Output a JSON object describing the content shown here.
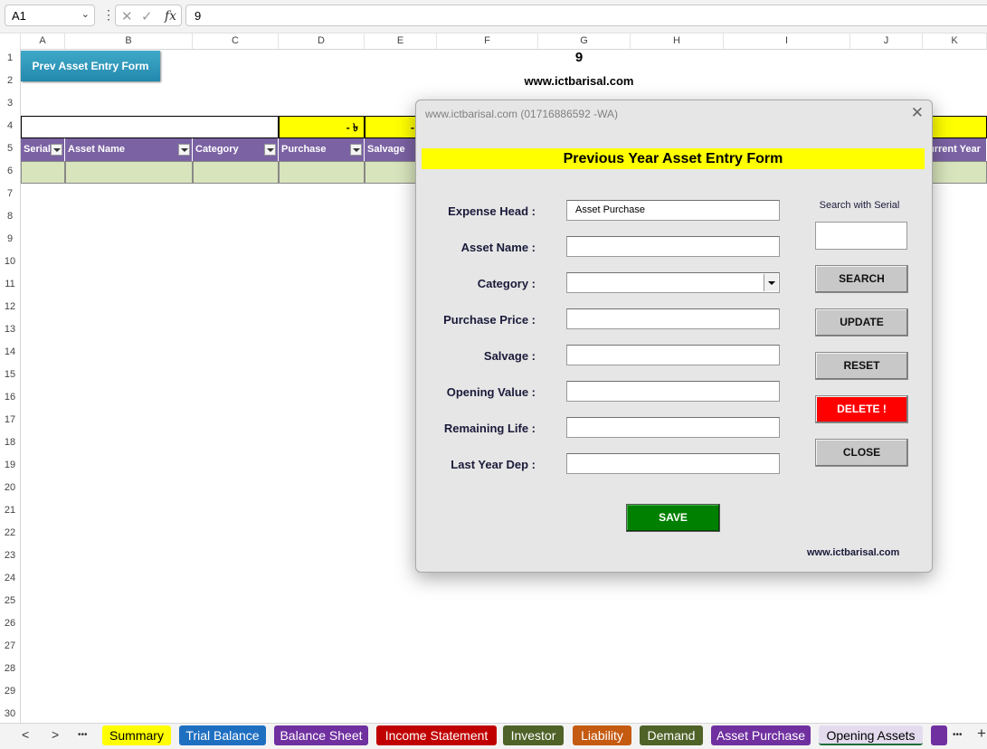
{
  "formula_bar": {
    "name_box": "A1",
    "fx": "fx",
    "value": "9"
  },
  "columns": [
    "A",
    "B",
    "C",
    "D",
    "E",
    "F",
    "G",
    "H",
    "I",
    "J",
    "K"
  ],
  "rows": [
    "1",
    "2",
    "3",
    "4",
    "5",
    "6",
    "7",
    "8",
    "9",
    "10",
    "11",
    "12",
    "13",
    "14",
    "15",
    "16",
    "17",
    "18",
    "19",
    "20",
    "21",
    "22",
    "23",
    "24",
    "25",
    "26",
    "27",
    "28",
    "29",
    "30"
  ],
  "sheet": {
    "prev_button": "Prev Asset Entry Form",
    "title_number": "9",
    "website": "www.ictbarisal.com",
    "row4": {
      "d_value": "-  ৳",
      "e_value": "-"
    },
    "table_headers": [
      "Serial",
      "Asset Name",
      "Category",
      "Purchase",
      "Salvage",
      "urrent Year"
    ]
  },
  "dialog": {
    "title": "www.ictbarisal.com (01716886592 -WA)",
    "heading": "Previous Year Asset Entry Form",
    "fields": [
      {
        "label": "Expense Head :",
        "value": "Asset Purchase"
      },
      {
        "label": "Asset Name :",
        "value": ""
      },
      {
        "label": "Category :",
        "value": ""
      },
      {
        "label": "Purchase Price :",
        "value": ""
      },
      {
        "label": "Salvage :",
        "value": ""
      },
      {
        "label": "Opening Value :",
        "value": ""
      },
      {
        "label": "Remaining Life :",
        "value": ""
      },
      {
        "label": "Last Year Dep :",
        "value": ""
      }
    ],
    "search_label": "Search with Serial",
    "buttons": {
      "search": "SEARCH",
      "update": "UPDATE",
      "reset": "RESET",
      "delete": "DELETE !",
      "close": "CLOSE",
      "save": "SAVE"
    },
    "footer": "www.ictbarisal.com",
    "colors": {
      "delete": "#ff0000",
      "save": "#008000",
      "heading_bg": "#ffff00"
    }
  },
  "tabs": [
    {
      "label": "Summary",
      "bg": "#ffff00",
      "fg": "#000000"
    },
    {
      "label": "Trial Balance",
      "bg": "#1f6fc1",
      "fg": "#ffffff"
    },
    {
      "label": "Balance Sheet",
      "bg": "#7030a0",
      "fg": "#ffffff"
    },
    {
      "label": "Income Statement",
      "bg": "#c00000",
      "fg": "#ffffff"
    },
    {
      "label": "Investor",
      "bg": "#4f6228",
      "fg": "#ffffff"
    },
    {
      "label": "Liability",
      "bg": "#c55a11",
      "fg": "#ffffff"
    },
    {
      "label": "Demand",
      "bg": "#4f6228",
      "fg": "#ffffff"
    },
    {
      "label": "Asset Purchase",
      "bg": "#7030a0",
      "fg": "#ffffff"
    },
    {
      "label": "Opening Assets",
      "bg": "#e4dcee",
      "fg": "#000000"
    }
  ],
  "tab_nav": {
    "prev": "<",
    "next": ">",
    "more": "•••",
    "add": "+"
  }
}
